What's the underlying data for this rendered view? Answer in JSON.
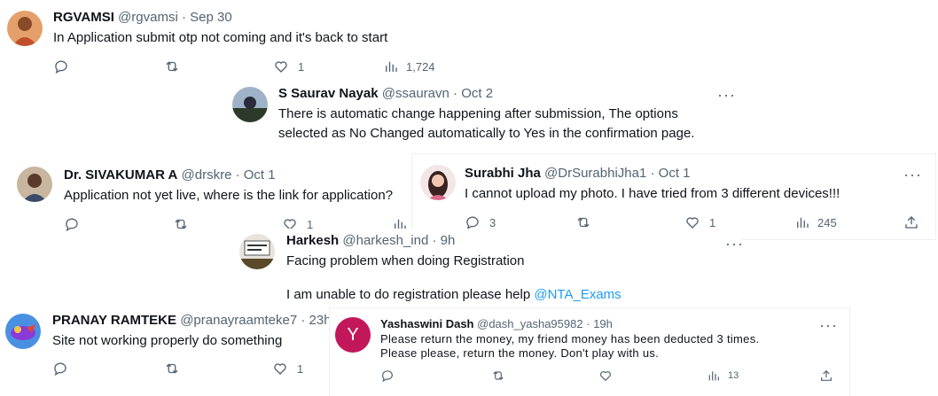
{
  "tweets": [
    {
      "name": "RGVAMSI",
      "handle": "@rgvamsi",
      "dot": "·",
      "time": "Sep 30",
      "text": "In Application submit otp not coming and it's back to start",
      "likes": "1",
      "views": "1,724",
      "avatar_color": "#d9774a"
    },
    {
      "name": "S Saurav Nayak",
      "handle": "@ssauravn",
      "dot": "·",
      "time": "Oct 2",
      "text": "There is automatic change happening after submission, The options selected as No Changed automatically to Yes in the confirmation page.",
      "more": "···",
      "avatar_color": "#3b4a5a"
    },
    {
      "name": "Dr. SIVAKUMAR A",
      "handle": "@drskre",
      "dot": "·",
      "time": "Oct 1",
      "text": "Application not yet live, where is the link for application?",
      "likes": "1",
      "avatar_color": "#7a5a44"
    },
    {
      "name": "Surabhi Jha",
      "handle": "@DrSurabhiJha1",
      "dot": "·",
      "time": "Oct 1",
      "text": "I cannot upload my photo. I have tried from 3 different devices!!!",
      "replies": "3",
      "likes": "1",
      "views": "245",
      "more": "···",
      "avatar_color": "#c98a8a"
    },
    {
      "name": "Harkesh",
      "handle": "@harkesh_ind",
      "dot": "·",
      "time": "9h",
      "text_line1": "Facing problem when doing Registration",
      "text_line2": "I am unable to do registration please help",
      "mention": "@NTA_Exams",
      "more": "···",
      "avatar_color": "#6b5a3a"
    },
    {
      "name": "PRANAY RAMTEKE",
      "handle": "@pranayraamteke7",
      "dot": "·",
      "time": "23h",
      "text": "Site not working properly do something",
      "likes": "1",
      "avatar_color": "#2f6fd6"
    },
    {
      "name": "Yashaswini Dash",
      "handle": "@dash_yasha95982",
      "dot": "·",
      "time": "19h",
      "initial": "Y",
      "text_line1": "Please return the money, my friend money has been deducted 3 times.",
      "text_line2": "Please please, return the money. Don't play with us.",
      "views": "13",
      "more": "···",
      "avatar_color": "#c2185b"
    }
  ]
}
